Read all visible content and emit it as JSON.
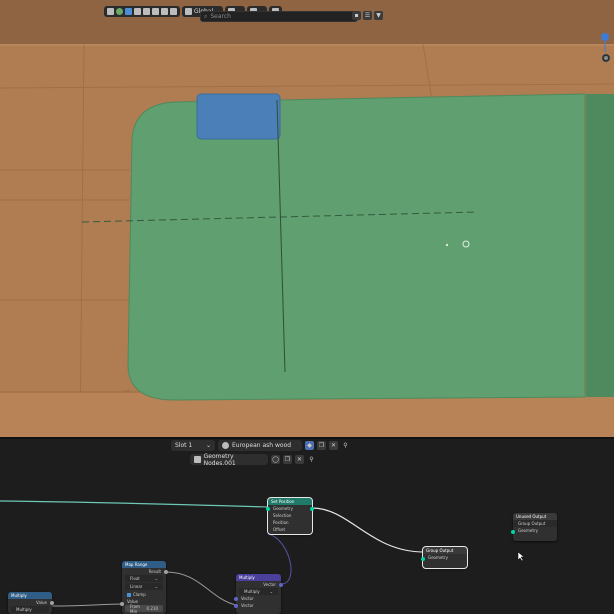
{
  "viewport_header": {
    "orientation_label": "Global",
    "search_placeholder": "Search"
  },
  "node_editor_header": {
    "slot_label": "Slot 1",
    "material_name": "European ash wood",
    "node_group_name": "Geometry Nodes.001"
  },
  "nodes": {
    "set_position": {
      "title": "Set Position",
      "rows": [
        "Geometry",
        "Selection",
        "Position",
        "Offset"
      ]
    },
    "group_output": {
      "title": "Group Output",
      "rows": [
        "Geometry"
      ]
    },
    "unused_output": {
      "title": "Unused Output",
      "subtitle": "Group Output",
      "rows": [
        "Geometry"
      ]
    },
    "map_range": {
      "title": "Map Range",
      "result": "Result",
      "type": "Float",
      "interp": "Linear",
      "clamp": "Clamp",
      "value_label": "Value",
      "field_label": "From Min",
      "field_value": "0.210"
    },
    "multiply": {
      "title": "Multiply",
      "vector_out": "Vector",
      "op": "Multiply",
      "rows": [
        "Vector",
        "Vector"
      ]
    },
    "left_node": {
      "title": "Multiply",
      "op": "Multiply",
      "value_out": "Value"
    }
  },
  "colors": {
    "wood": "#b07d52",
    "green_plane": "#5f9f70",
    "blue_box": "#4a7fb8",
    "geometry_socket": "#00d6a3",
    "vector_socket": "#6363c7",
    "float_socket": "#a1a1a1"
  }
}
